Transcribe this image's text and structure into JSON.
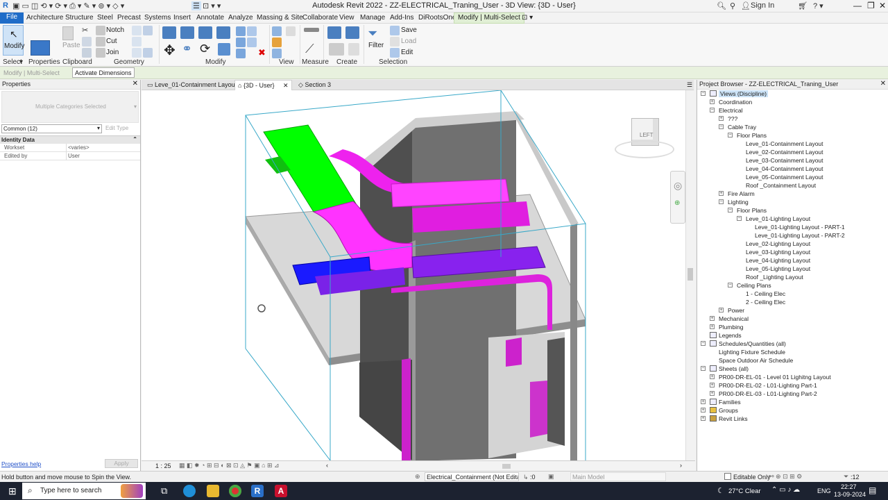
{
  "window": {
    "title": "Autodesk Revit 2022 - ZZ-ELECTRICAL_Traning_User - 3D View: {3D - User}",
    "sign_in": "Sign In"
  },
  "menu": {
    "tabs": [
      "File",
      "Architecture",
      "Structure",
      "Steel",
      "Precast",
      "Systems",
      "Insert",
      "Annotate",
      "Analyze",
      "Massing & Site",
      "Collaborate",
      "View",
      "Manage",
      "Add-Ins",
      "DiRootsOne",
      "Modify | Multi-Select"
    ]
  },
  "ribbon": {
    "modify": "Modify",
    "properties": "Properties",
    "paste": "Paste",
    "notch": "Notch",
    "cut": "Cut",
    "join": "Join",
    "filter": "Filter",
    "save": "Save",
    "load": "Load",
    "edit": "Edit",
    "groups": {
      "select": "Select",
      "properties": "Properties",
      "clipboard": "Clipboard",
      "geometry": "Geometry",
      "modify": "Modify",
      "view": "View",
      "measure": "Measure",
      "create": "Create",
      "selection": "Selection"
    }
  },
  "options_bar": {
    "context": "Modify | Multi-Select",
    "activate_dimensions": "Activate Dimensions"
  },
  "properties_panel": {
    "title": "Properties",
    "type_selector": "Multiple Categories Selected",
    "filter": "Common (12)",
    "edit_type": "Edit Type",
    "section": "Identity Data",
    "rows": [
      {
        "label": "Workset",
        "value": "<varies>"
      },
      {
        "label": "Edited by",
        "value": "User"
      }
    ],
    "help": "Properties help",
    "apply": "Apply"
  },
  "view_tabs": [
    {
      "label": "Leve_01-Containment Layout"
    },
    {
      "label": "{3D - User}"
    },
    {
      "label": "Section 3"
    }
  ],
  "viewcube": {
    "face": "LEFT"
  },
  "view_bar": {
    "scale": "1 : 25"
  },
  "project_browser": {
    "title": "Project Browser - ZZ-ELECTRICAL_Traning_User",
    "items": [
      {
        "label": "Views (Discipline)",
        "level": 0,
        "toggle": "-"
      },
      {
        "label": "Coordination",
        "level": 1,
        "toggle": "+"
      },
      {
        "label": "Electrical",
        "level": 1,
        "toggle": "-"
      },
      {
        "label": "???",
        "level": 2,
        "toggle": "+"
      },
      {
        "label": "Cable Tray",
        "level": 2,
        "toggle": "-"
      },
      {
        "label": "Floor Plans",
        "level": 3,
        "toggle": "-"
      },
      {
        "label": "Leve_01-Containment Layout",
        "level": 4,
        "toggle": ""
      },
      {
        "label": "Leve_02-Containment Layout",
        "level": 4,
        "toggle": ""
      },
      {
        "label": "Leve_03-Containment Layout",
        "level": 4,
        "toggle": ""
      },
      {
        "label": "Leve_04-Containment Layout",
        "level": 4,
        "toggle": ""
      },
      {
        "label": "Leve_05-Containment Layout",
        "level": 4,
        "toggle": ""
      },
      {
        "label": "Roof _Containment Layout",
        "level": 4,
        "toggle": ""
      },
      {
        "label": "Fire Alarm",
        "level": 2,
        "toggle": "+"
      },
      {
        "label": "Lighting",
        "level": 2,
        "toggle": "-"
      },
      {
        "label": "Floor Plans",
        "level": 3,
        "toggle": "-"
      },
      {
        "label": "Leve_01-Lighting Layout",
        "level": 4,
        "toggle": "-"
      },
      {
        "label": "Leve_01-Lighting Layout - PART-1",
        "level": 5,
        "toggle": ""
      },
      {
        "label": "Leve_01-Lighting Layout - PART-2",
        "level": 5,
        "toggle": ""
      },
      {
        "label": "Leve_02-Lighting Layout",
        "level": 4,
        "toggle": ""
      },
      {
        "label": "Leve_03-Lighting Layout",
        "level": 4,
        "toggle": ""
      },
      {
        "label": "Leve_04-Lighting Layout",
        "level": 4,
        "toggle": ""
      },
      {
        "label": "Leve_05-Lighting Layout",
        "level": 4,
        "toggle": ""
      },
      {
        "label": "Roof _Lighting Layout",
        "level": 4,
        "toggle": ""
      },
      {
        "label": "Ceiling Plans",
        "level": 3,
        "toggle": "-"
      },
      {
        "label": "1 - Ceiling Elec",
        "level": 4,
        "toggle": ""
      },
      {
        "label": "2 - Ceiling Elec",
        "level": 4,
        "toggle": ""
      },
      {
        "label": "Power",
        "level": 2,
        "toggle": "+"
      },
      {
        "label": "Mechanical",
        "level": 1,
        "toggle": "+"
      },
      {
        "label": "Plumbing",
        "level": 1,
        "toggle": "+"
      },
      {
        "label": "Legends",
        "level": 0,
        "toggle": ""
      },
      {
        "label": "Schedules/Quantities (all)",
        "level": 0,
        "toggle": "-"
      },
      {
        "label": "Lighting Fixture Schedule",
        "level": 1,
        "toggle": ""
      },
      {
        "label": "Space Outdoor Air Schedule",
        "level": 1,
        "toggle": ""
      },
      {
        "label": "Sheets (all)",
        "level": 0,
        "toggle": "-"
      },
      {
        "label": "PR00-DR-EL-01 - Level 01 Lighitng Layout",
        "level": 1,
        "toggle": "+"
      },
      {
        "label": "PR00-DR-EL-02 - L01-Lighting Part-1",
        "level": 1,
        "toggle": "+"
      },
      {
        "label": "PR00-DR-EL-03 - L01-Lighting Part-2",
        "level": 1,
        "toggle": "+"
      },
      {
        "label": "Families",
        "level": 0,
        "toggle": "+"
      },
      {
        "label": "Groups",
        "level": 0,
        "toggle": "+"
      },
      {
        "label": "Revit Links",
        "level": 0,
        "toggle": "+"
      }
    ]
  },
  "status_bar": {
    "message": "Hold button and move mouse to Spin the View.",
    "workset": "Electrical_Containment (Not Editab",
    "selected": ":0",
    "design_option": "Main Model",
    "editable_only": "Editable Only",
    "filter_count": ":12"
  },
  "taskbar": {
    "search": "Type here to search",
    "weather": "27°C  Clear",
    "lang": "ENG",
    "time": "22:27",
    "date": "13-09-2024"
  },
  "colors": {
    "accent": "#1f6cc8",
    "tray_green": "#00ff00",
    "tray_magenta": "#ff33ff",
    "tray_blue": "#1a1aff",
    "tray_purple": "#8822ee",
    "taskbar": "#1c2230"
  }
}
